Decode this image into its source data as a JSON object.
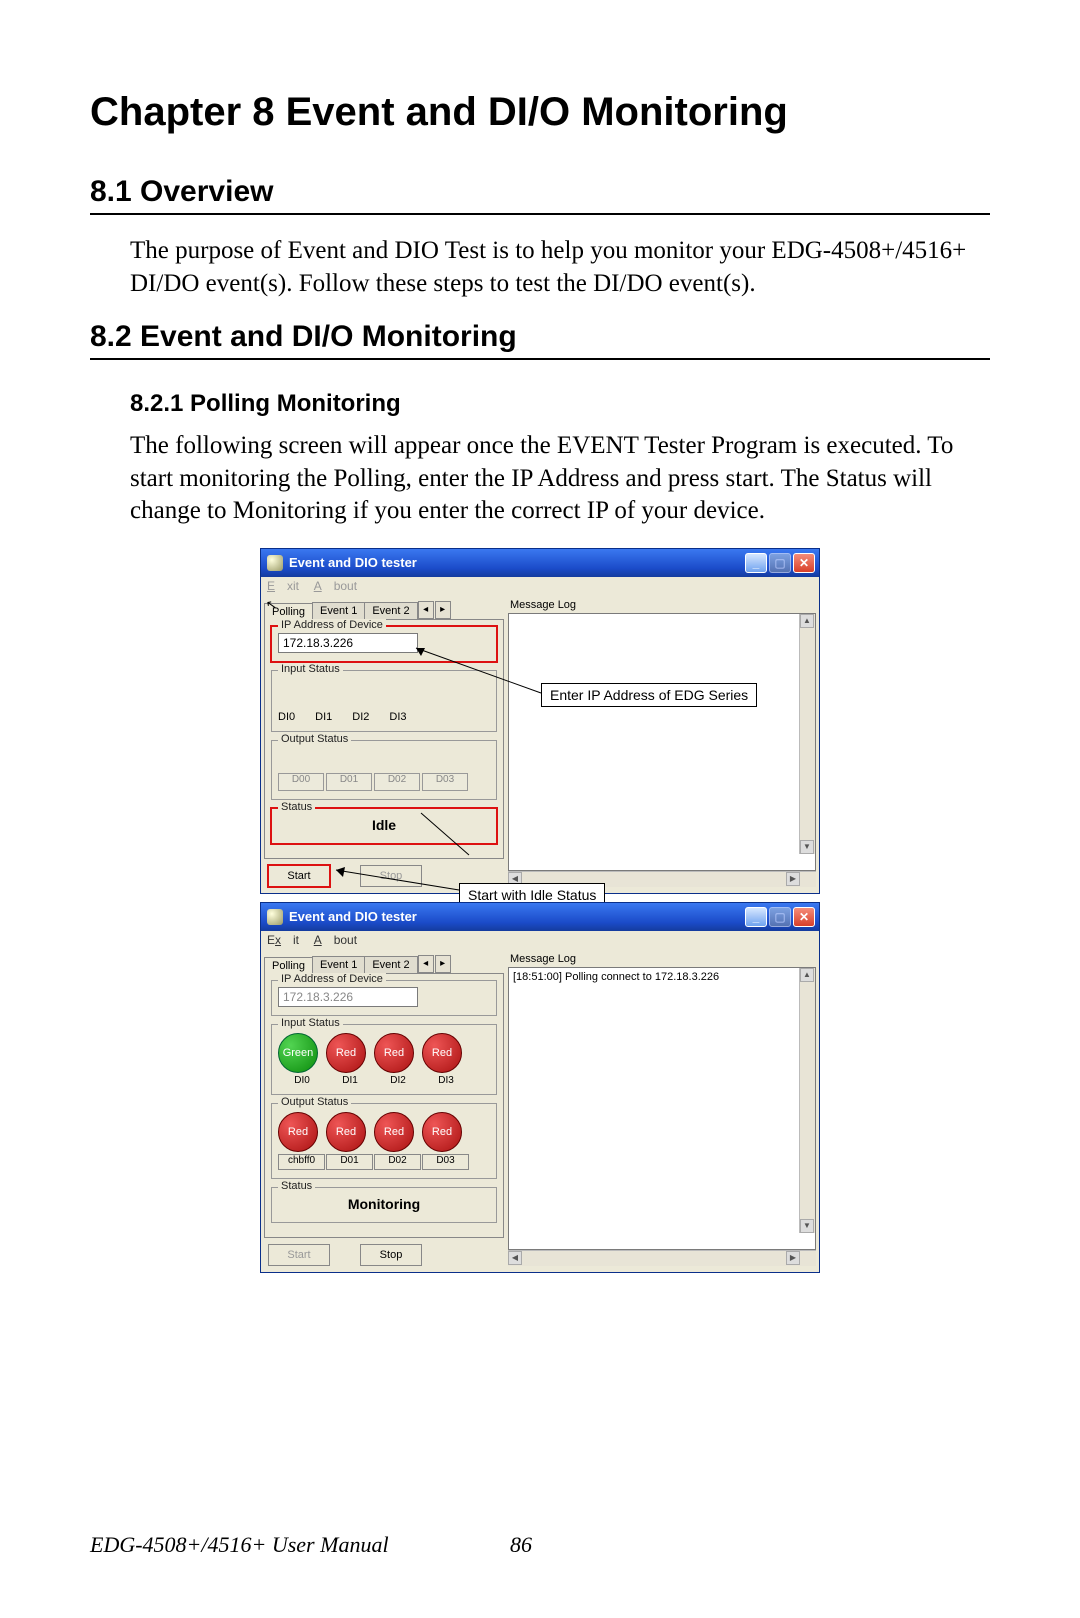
{
  "chapter_title": "Chapter 8  Event and DI/O Monitoring",
  "section_81_title": "8.1  Overview",
  "section_81_body": "The purpose of Event and DIO Test is to help you monitor your EDG-4508+/4516+ DI/DO event(s). Follow these steps to test the DI/DO event(s).",
  "section_82_title": "8.2  Event and DI/O Monitoring",
  "subsection_821_title": "8.2.1 Polling Monitoring",
  "subsection_821_body": "The following screen will appear once the EVENT Tester Program is executed. To start monitoring the Polling, enter the IP Address and press start. The Status will change to Monitoring if you enter the correct IP of your device.",
  "callouts": {
    "ip": "Enter IP Address of EDG Series",
    "start": "Start with Idle Status"
  },
  "win1": {
    "title": "Event and DIO tester",
    "menu": {
      "exit": "Exit",
      "about": "About"
    },
    "tabs": [
      "Polling",
      "Event 1",
      "Event 2"
    ],
    "group_ip": "IP Address of Device",
    "ip_value": "172.18.3.226",
    "group_input": "Input Status",
    "di": [
      "DI0",
      "DI1",
      "DI2",
      "DI3"
    ],
    "group_output": "Output Status",
    "do": [
      "D00",
      "D01",
      "D02",
      "D03"
    ],
    "group_status": "Status",
    "status_val": "Idle",
    "btn_start": "Start",
    "btn_stop": "Stop",
    "msglog_label": "Message Log"
  },
  "win2": {
    "title": "Event and DIO tester",
    "menu": {
      "exit": "Exit",
      "about": "About"
    },
    "tabs": [
      "Polling",
      "Event 1",
      "Event 2"
    ],
    "group_ip": "IP Address of Device",
    "ip_value": "172.18.3.226",
    "group_input": "Input Status",
    "leds_in": [
      "Green",
      "Red",
      "Red",
      "Red"
    ],
    "di": [
      "DI0",
      "DI1",
      "DI2",
      "DI3"
    ],
    "group_output": "Output Status",
    "leds_out": [
      "Red",
      "Red",
      "Red",
      "Red"
    ],
    "do": [
      "chbff0",
      "D01",
      "D02",
      "D03"
    ],
    "group_status": "Status",
    "status_val": "Monitoring",
    "btn_start": "Start",
    "btn_stop": "Stop",
    "msglog_label": "Message Log",
    "log_line": "[18:51:00] Polling connect to 172.18.3.226"
  },
  "footer": "EDG-4508+/4516+ User Manual",
  "page_number": "86"
}
